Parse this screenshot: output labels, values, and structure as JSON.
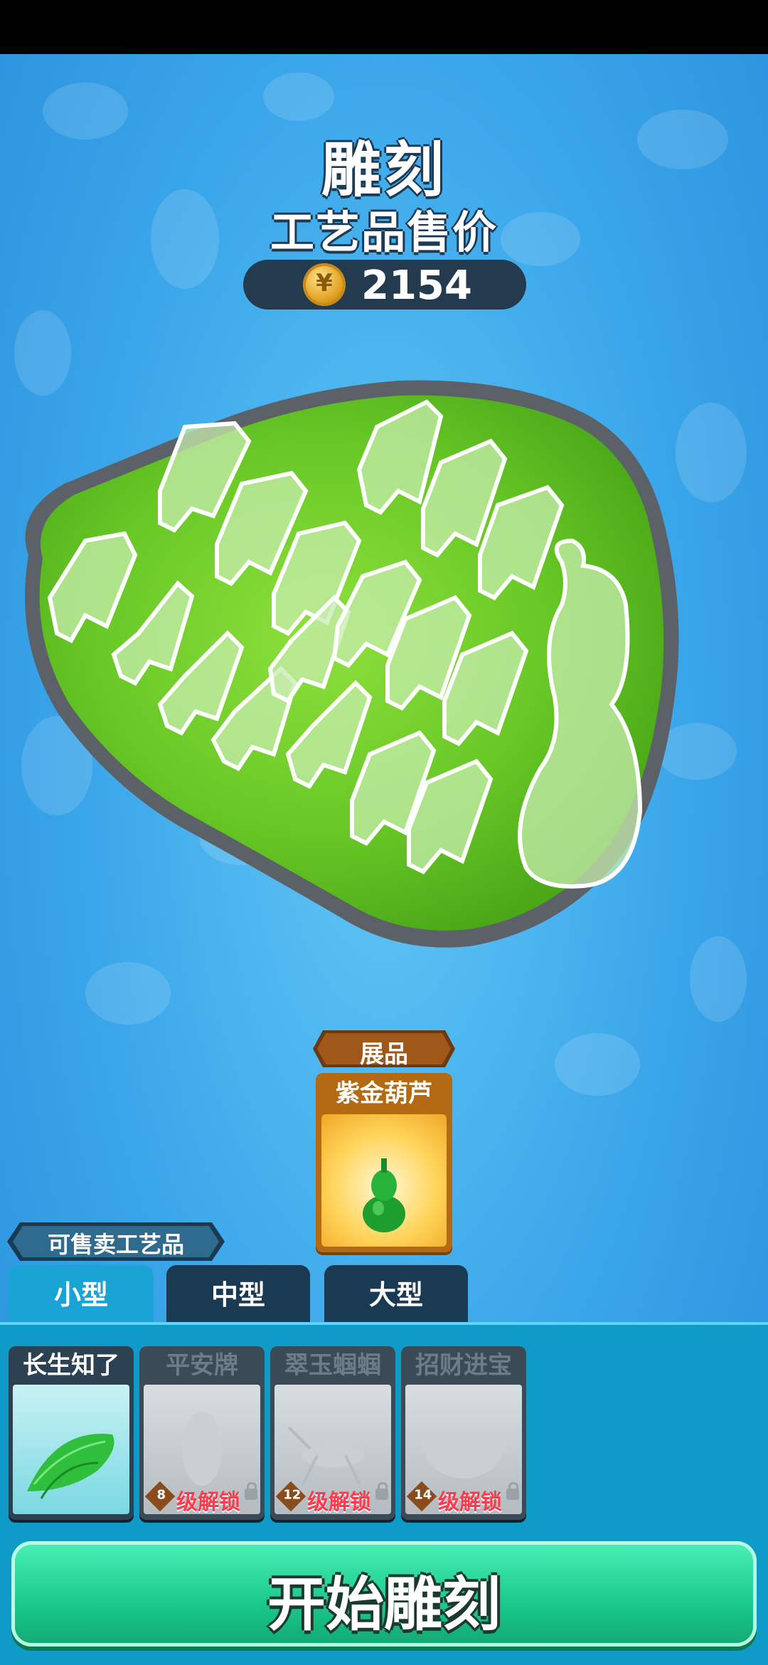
{
  "header": {
    "title": "雕刻",
    "subtitle": "工艺品售价",
    "price": "2154",
    "coin_icon": "coin-icon"
  },
  "exhibit": {
    "banner": "展品",
    "name": "紫金葫芦"
  },
  "sellable": {
    "banner": "可售卖工艺品"
  },
  "tabs": [
    {
      "label": "小型",
      "active": true
    },
    {
      "label": "中型",
      "active": false
    },
    {
      "label": "大型",
      "active": false
    }
  ],
  "items": [
    {
      "name": "长生知了",
      "locked": false
    },
    {
      "name": "平安牌",
      "locked": true,
      "level": "8",
      "unlock_text": "级解锁"
    },
    {
      "name": "翠玉蝈蝈",
      "locked": true,
      "level": "12",
      "unlock_text": "级解锁"
    },
    {
      "name": "招财进宝",
      "locked": true,
      "level": "14",
      "unlock_text": "级解锁"
    }
  ],
  "start_button": {
    "label": "开始雕刻"
  },
  "colors": {
    "jade": "#6fcf2a",
    "start": "#1ac98a",
    "price_pill": "#243b4f"
  }
}
